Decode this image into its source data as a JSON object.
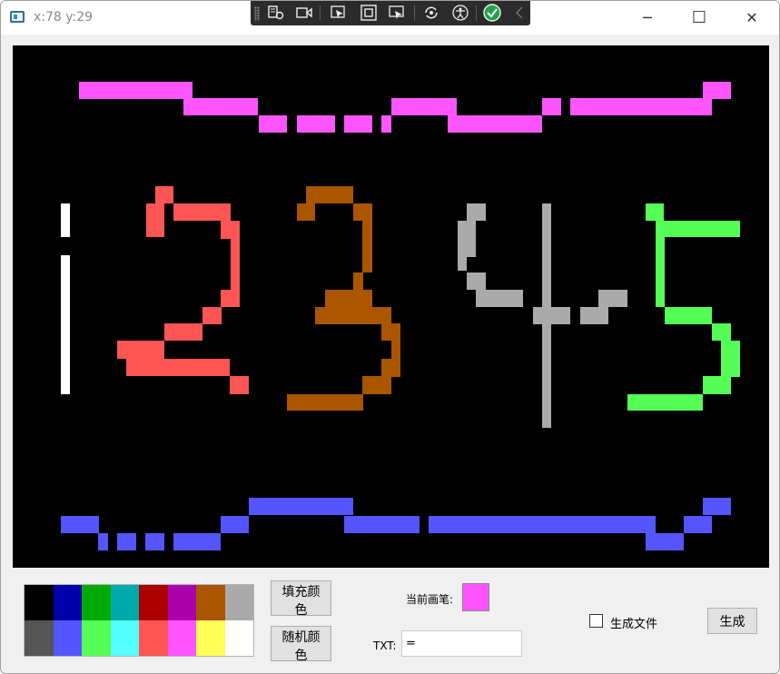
{
  "window": {
    "title": "x:78 y:29",
    "caption_buttons": {
      "minimize": "─",
      "maximize": "☐",
      "close": "✕"
    }
  },
  "debug_toolbar": {
    "icons": [
      "grip",
      "live-visual-tree-icon",
      "record-icon",
      "select-element-icon",
      "display-layout-adorners-icon",
      "track-focus-icon",
      "hot-reload-icon",
      "accessibility-icon",
      "binding-failures-ok-icon",
      "collapse-chevron-icon"
    ]
  },
  "canvas": {
    "background": "#000000",
    "pixel_art_colors": {
      "white": "#ffffff",
      "red": "#ff5555",
      "brown": "#aa5500",
      "gray": "#aaaaaa",
      "green": "#55ff55",
      "magenta": "#ff55ff",
      "blue": "#5555ff"
    }
  },
  "palette": {
    "colors": [
      "#000000",
      "#0000aa",
      "#00aa00",
      "#00aaaa",
      "#aa0000",
      "#aa00aa",
      "#aa5500",
      "#aaaaaa",
      "#555555",
      "#5555ff",
      "#55ff55",
      "#55ffff",
      "#ff5555",
      "#ff55ff",
      "#ffff55",
      "#ffffff"
    ]
  },
  "controls": {
    "fill_color_button": "填充颜色",
    "random_color_button": "随机颜色",
    "current_pen_label": "当前画笔:",
    "current_pen_color": "#ff55ff",
    "txt_label": "TXT:",
    "txt_value": "=",
    "generate_file_label": "生成文件",
    "generate_file_checked": false,
    "generate_button": "生成"
  }
}
